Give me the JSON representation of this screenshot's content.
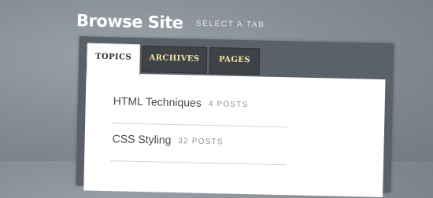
{
  "header": {
    "title": "Browse Site",
    "subtitle": "SELECT A TAB"
  },
  "tabs": [
    {
      "label": "TOPICS",
      "active": true
    },
    {
      "label": "ARCHIVES",
      "active": false
    },
    {
      "label": "PAGES",
      "active": false
    }
  ],
  "topics": [
    {
      "name": "HTML Techniques",
      "count": "4 POSTS"
    },
    {
      "name": "CSS Styling",
      "count": "32 POSTS"
    }
  ],
  "colors": {
    "background": "#878e96",
    "widget_frame": "#5b6168",
    "inactive_tab": "#3f4348",
    "inactive_tab_text": "#f2e6a8",
    "active_tab": "#ffffff"
  }
}
